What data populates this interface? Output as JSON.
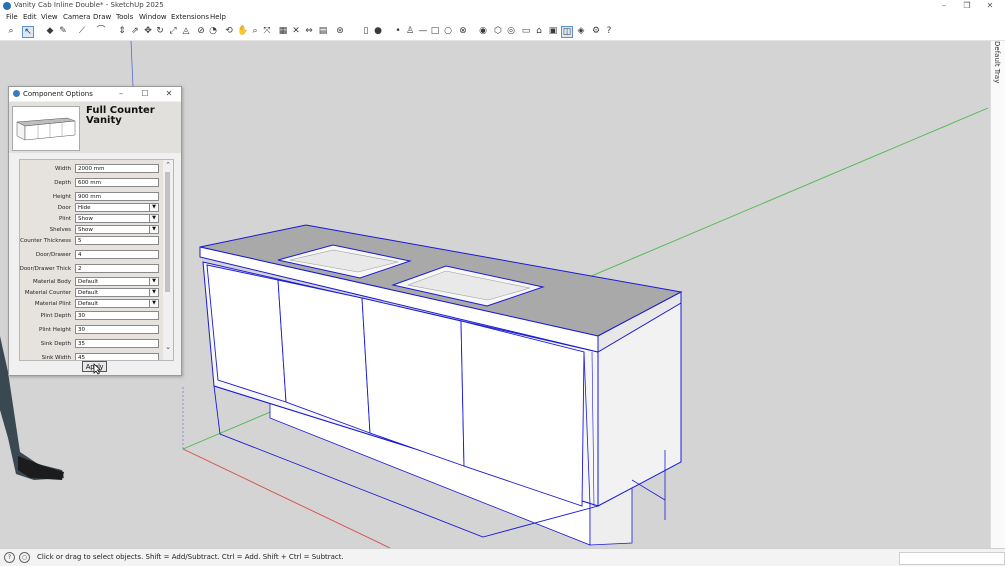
{
  "window": {
    "title": "Vanity Cab Inline Double* - SketchUp 2025"
  },
  "menu": [
    "File",
    "Edit",
    "View",
    "Camera",
    "Draw",
    "Tools",
    "Window",
    "Extensions",
    "Help"
  ],
  "tray": {
    "label": "Default Tray"
  },
  "status": {
    "text": "Click or drag to select objects. Shift = Add/Subtract. Ctrl = Add. Shift + Ctrl = Subtract."
  },
  "dialog": {
    "title": "Component Options",
    "component_name": "Full Counter Vanity",
    "fields": [
      {
        "label": "Width",
        "value": "2000 mm",
        "type": "text"
      },
      {
        "label": "Depth",
        "value": "600 mm",
        "type": "text"
      },
      {
        "label": "Height",
        "value": "900 mm",
        "type": "text"
      },
      {
        "label": "Door",
        "value": "Hide",
        "type": "select"
      },
      {
        "label": "Plint",
        "value": "Show",
        "type": "select"
      },
      {
        "label": "Shelves",
        "value": "Show",
        "type": "select"
      },
      {
        "label": "Counter Thickness",
        "value": "5",
        "type": "text"
      },
      {
        "label": "Door/Drawer",
        "value": "4",
        "type": "text"
      },
      {
        "label": "Door/Drawer Thick",
        "value": "2",
        "type": "text"
      },
      {
        "label": "Material Body",
        "value": "Default",
        "type": "select"
      },
      {
        "label": "Material Counter",
        "value": "Default",
        "type": "select"
      },
      {
        "label": "Material Plint",
        "value": "Default",
        "type": "select"
      },
      {
        "label": "Plint Depth",
        "value": "30",
        "type": "text"
      },
      {
        "label": "Plint Height",
        "value": "30",
        "type": "text"
      },
      {
        "label": "Sink Depth",
        "value": "35",
        "type": "text"
      },
      {
        "label": "Sink Width",
        "value": "45",
        "type": "text"
      }
    ],
    "apply_label": "Apply"
  },
  "colors": {
    "axis_red": "#d84a4a",
    "axis_green": "#4cb84c",
    "axis_blue": "#5a6bc8",
    "selection": "#1a1ad6",
    "counter": "#a9a9a9"
  }
}
